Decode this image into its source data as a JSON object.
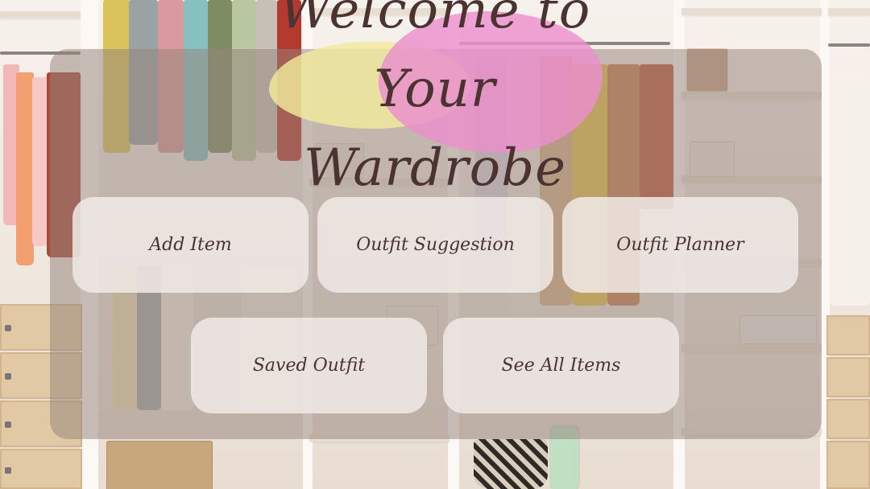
{
  "title": "Welcome to\nYour Wardrobe",
  "menu": {
    "add_item": "Add Item",
    "outfit_suggestion": "Outfit Suggestion",
    "outfit_planner": "Outfit Planner",
    "saved_outfit": "Saved Outfit",
    "see_all_items": "See All Items"
  },
  "colors": {
    "text": "#4a3330",
    "button_bg": "#f0e9e5",
    "overlay": "#96847a",
    "blob_yellow": "#f0ea9e",
    "blob_pink": "#ec8fcd"
  }
}
